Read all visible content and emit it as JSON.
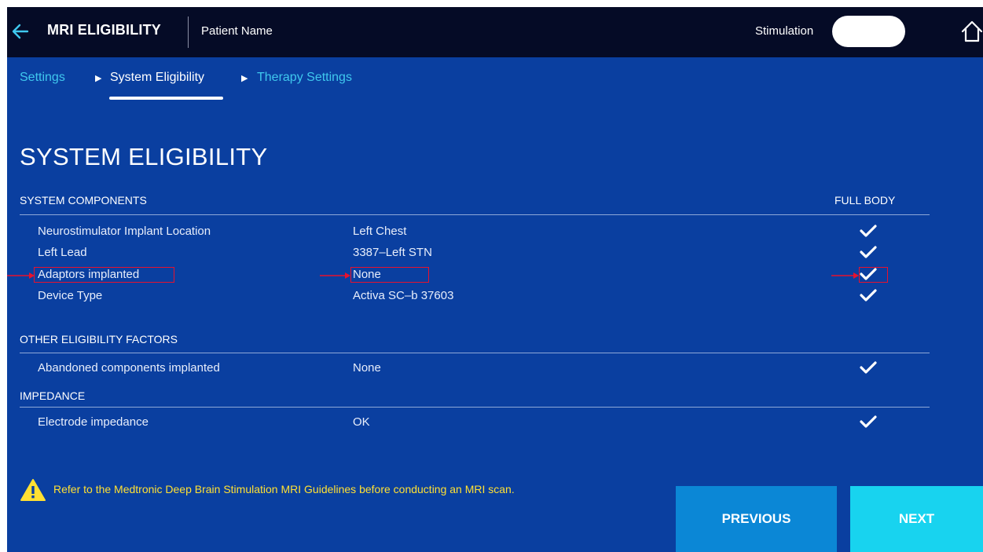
{
  "header": {
    "title": "MRI ELIGIBILITY",
    "patient_name": "Patient Name",
    "stimulation_label": "Stimulation",
    "icons": {
      "back": "back-arrow-icon",
      "home": "home-icon",
      "toggle": "stimulation-toggle"
    }
  },
  "breadcrumb": {
    "items": [
      "Settings",
      "System Eligibility",
      "Therapy Settings"
    ],
    "current_index": 1
  },
  "page": {
    "title": "SYSTEM ELIGIBILITY"
  },
  "columns": {
    "full_body": "FULL BODY"
  },
  "sections": {
    "system_components": {
      "title": "SYSTEM COMPONENTS",
      "rows": [
        {
          "label": "Neurostimulator Implant Location",
          "value": "Left Chest",
          "full_body": true
        },
        {
          "label": "Left Lead",
          "value": "3387–Left STN",
          "full_body": true
        },
        {
          "label": "Adaptors implanted",
          "value": "None",
          "full_body": true,
          "highlighted": true
        },
        {
          "label": "Device Type",
          "value": "Activa SC–b 37603",
          "full_body": true
        }
      ]
    },
    "other_factors": {
      "title": "OTHER ELIGIBILITY FACTORS",
      "rows": [
        {
          "label": "Abandoned components implanted",
          "value": "None",
          "full_body": true
        }
      ]
    },
    "impedance": {
      "title": "IMPEDANCE",
      "rows": [
        {
          "label": "Electrode impedance",
          "value": "OK",
          "full_body": true
        }
      ]
    }
  },
  "warning": {
    "text": "Refer to the Medtronic Deep Brain Stimulation MRI Guidelines before conducting an MRI scan.",
    "icon": "warning-triangle-icon"
  },
  "buttons": {
    "previous": "PREVIOUS",
    "next": "NEXT"
  },
  "colors": {
    "background": "#0a3fa0",
    "header": "#050b26",
    "link": "#3fc8ee",
    "warning": "#ffe033",
    "previous_button": "#0b87d6",
    "next_button": "#18d3ef",
    "annotation": "#e8112d"
  }
}
